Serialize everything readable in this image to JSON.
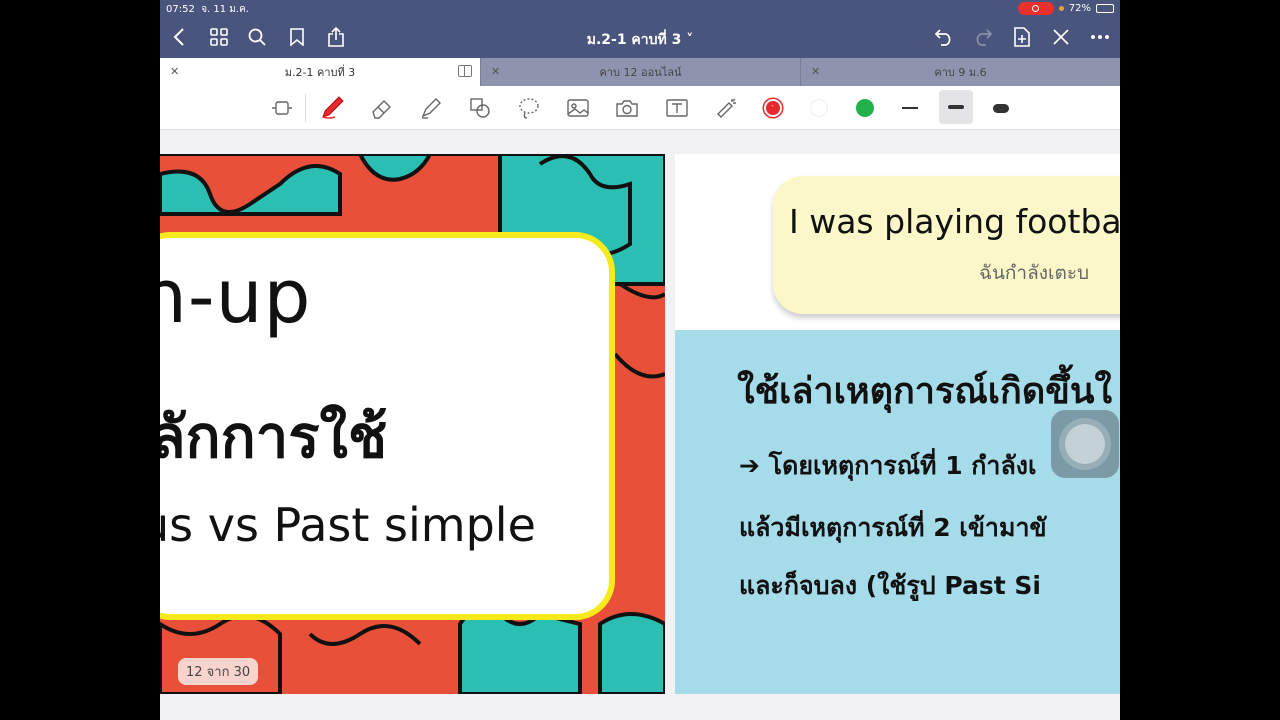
{
  "status": {
    "time": "07:52",
    "date": "จ. 11 ม.ค.",
    "battery": "72%",
    "battery_level": 0.72
  },
  "header": {
    "title": "ม.2-1 คาบที่ 3 ˅"
  },
  "tabs": [
    {
      "label": "ม.2-1 คาบที่ 3",
      "active": true
    },
    {
      "label": "คาบ 12 ออนไลน์",
      "active": false
    },
    {
      "label": "คาบ 9 ม.6",
      "active": false
    }
  ],
  "toolbar": {
    "colors": [
      "#e8262c",
      "#ffffff",
      "#22b14c"
    ],
    "selected_color": "#e8262c"
  },
  "slide_left": {
    "warm_up": "n-up",
    "principle": "ลักการใช้",
    "vs_text": "us vs Past simple",
    "page_indicator": "12 จาก 30"
  },
  "slide_right": {
    "eng_sentence": "I was playing footba",
    "thai_sentence": "ฉันกำลังเตะบ",
    "heading": "ใช้เล่าเหตุการณ์เกิดขึ้นใ",
    "line1": "➔ โดยเหตุการณ์ที่ 1 กำลังเ",
    "line2": "แล้วมีเหตุการณ์ที่ 2 เข้ามาขั",
    "line3": "และก็จบลง (ใช้รูป Past Si"
  }
}
